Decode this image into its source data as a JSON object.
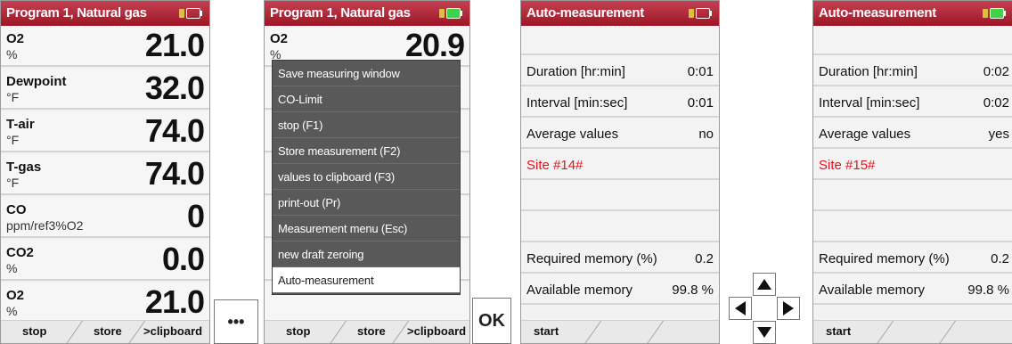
{
  "screen1": {
    "title": "Program 1, Natural gas",
    "rows": [
      {
        "label": "O2",
        "unit": "%",
        "value": "21.0"
      },
      {
        "label": "Dewpoint",
        "unit": "°F",
        "value": "32.0"
      },
      {
        "label": "T-air",
        "unit": "°F",
        "value": "74.0"
      },
      {
        "label": "T-gas",
        "unit": "°F",
        "value": "74.0"
      },
      {
        "label": "CO",
        "unit": "ppm/ref3%O2",
        "value": "0"
      },
      {
        "label": "CO2",
        "unit": "%",
        "value": "0.0"
      },
      {
        "label": "O2",
        "unit": "%",
        "value": "21.0"
      }
    ],
    "softkeys": [
      "stop",
      "store",
      ">clipboard"
    ]
  },
  "more_button": "•••",
  "screen2": {
    "title": "Program 1, Natural gas",
    "bg_rows": [
      {
        "label": "O2",
        "unit": "%",
        "value": "20.9"
      }
    ],
    "menu_items": [
      "Save measuring window",
      "CO-Limit",
      "stop (F1)",
      "Store measurement (F2)",
      "values to clipboard (F3)",
      "print-out (Pr)",
      "Measurement menu (Esc)",
      "new draft zeroing",
      "Auto-measurement"
    ],
    "softkeys": [
      "stop",
      "store",
      ">clipboard"
    ]
  },
  "ok_button": "OK",
  "screen3": {
    "title": "Auto-measurement",
    "rows": [
      {
        "label": "",
        "value": ""
      },
      {
        "label": "Duration [hr:min]",
        "value": "0:01"
      },
      {
        "label": "Interval [min:sec]",
        "value": "0:01"
      },
      {
        "label": "Average values",
        "value": "no"
      },
      {
        "label": "Site #14#",
        "value": "",
        "red": true
      },
      {
        "label": "",
        "value": ""
      },
      {
        "label": "",
        "value": ""
      },
      {
        "label": "Required memory (%)",
        "value": "0.2"
      },
      {
        "label": "Available memory",
        "value": "99.8 %"
      }
    ],
    "softkeys": [
      "start"
    ]
  },
  "screen4": {
    "title": "Auto-measurement",
    "rows": [
      {
        "label": "",
        "value": ""
      },
      {
        "label": "Duration [hr:min]",
        "value": "0:02"
      },
      {
        "label": "Interval [min:sec]",
        "value": "0:02"
      },
      {
        "label": "Average values",
        "value": "yes"
      },
      {
        "label": "Site #15#",
        "value": "",
        "red": true
      },
      {
        "label": "",
        "value": ""
      },
      {
        "label": "",
        "value": ""
      },
      {
        "label": "Required memory (%)",
        "value": "0.2"
      },
      {
        "label": "Available memory",
        "value": "99.8 %"
      }
    ],
    "softkeys": [
      "start"
    ]
  },
  "colors": {
    "titlebar": "#b22a3a",
    "highlight_red": "#e2141b",
    "menu_bg": "#595959"
  },
  "icons": [
    "battery-icon",
    "arrow-up-icon",
    "arrow-down-icon",
    "arrow-left-icon",
    "arrow-right-icon"
  ]
}
